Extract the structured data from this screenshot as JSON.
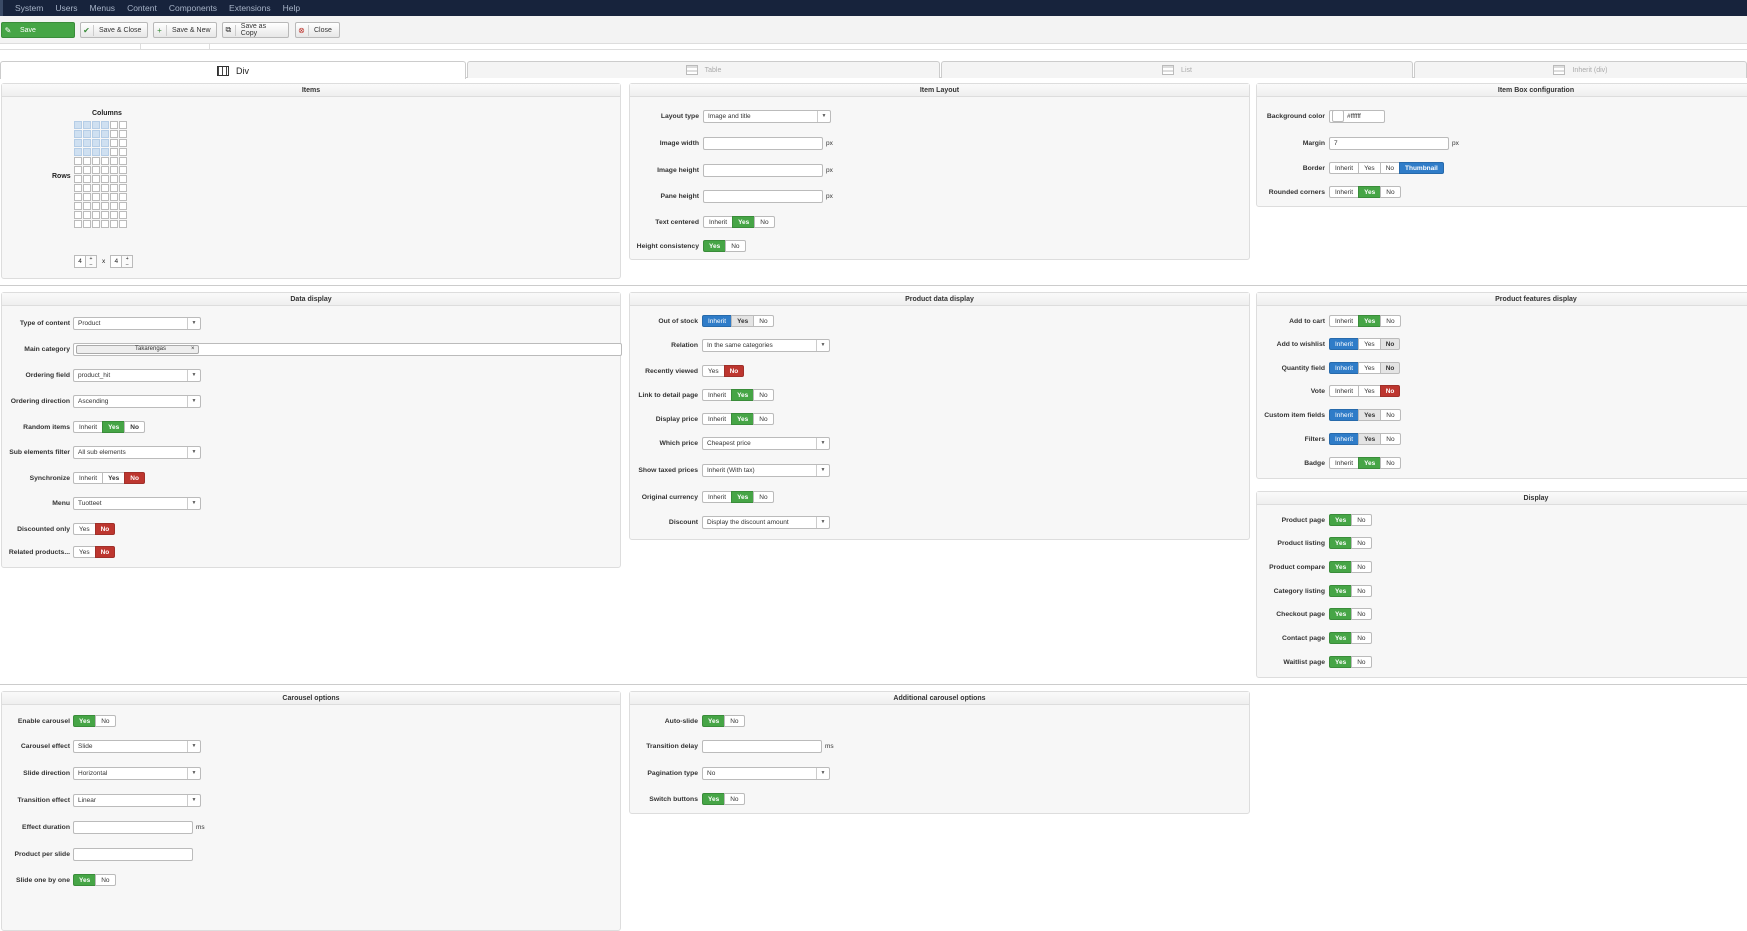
{
  "nav": [
    "System",
    "Users",
    "Menus",
    "Content",
    "Components",
    "Extensions",
    "Help"
  ],
  "toolbar": {
    "save": "Save",
    "save_close": "Save & Close",
    "save_new": "Save & New",
    "save_copy": "Save as Copy",
    "close": "Close"
  },
  "tabs": [
    "Div",
    "Table",
    "List",
    "Inherit (div)"
  ],
  "items": {
    "title": "Items",
    "columns_label": "Columns",
    "rows_label": "Rows",
    "cols_value": "4",
    "x": "x",
    "rows_value": "4"
  },
  "layout": {
    "title": "Item Layout",
    "layout_type_label": "Layout type",
    "layout_type": "Image and title",
    "image_width": "Image width",
    "image_height": "Image height",
    "pane_height": "Pane height",
    "px": "px",
    "text_centered": "Text centered",
    "height_consistency": "Height consistency"
  },
  "box": {
    "title": "Item Box configuration",
    "bg_color": "Background color",
    "bg_value": "#ffffff",
    "margin": "Margin",
    "margin_value": "7",
    "border": "Border",
    "rounded": "Rounded corners",
    "thumbnail": "Thumbnail"
  },
  "opts": {
    "inherit": "Inherit",
    "yes": "Yes",
    "no": "No"
  },
  "data": {
    "title": "Data display",
    "type": "Type of content",
    "type_val": "Product",
    "main_cat": "Main category",
    "main_cat_tag": "Takarengas",
    "ordering": "Ordering field",
    "ordering_val": "product_hit",
    "direction": "Ordering direction",
    "direction_val": "Ascending",
    "random": "Random items",
    "sub_filter": "Sub elements filter",
    "sub_filter_val": "All sub elements",
    "sync": "Synchronize",
    "menu": "Menu",
    "menu_val": "Tuotteet",
    "discounted": "Discounted only",
    "related": "Related products..."
  },
  "pdata": {
    "title": "Product data display",
    "out_of_stock": "Out of stock",
    "relation": "Relation",
    "relation_val": "In the same categories",
    "recent": "Recently viewed",
    "link": "Link to detail page",
    "price": "Display price",
    "which": "Which price",
    "which_val": "Cheapest price",
    "taxed": "Show taxed prices",
    "taxed_val": "Inherit (With tax)",
    "orig_cur": "Original currency",
    "discount": "Discount",
    "discount_val": "Display the discount amount"
  },
  "feat": {
    "title": "Product features display",
    "cart": "Add to cart",
    "wishlist": "Add to wishlist",
    "qty": "Quantity field",
    "vote": "Vote",
    "custom": "Custom item fields",
    "filters": "Filters",
    "badge": "Badge"
  },
  "display": {
    "title": "Display",
    "product_page": "Product page",
    "listing": "Product listing",
    "compare": "Product compare",
    "category": "Category listing",
    "checkout": "Checkout page",
    "contact": "Contact page",
    "waitlist": "Waitlist page"
  },
  "carousel": {
    "title": "Carousel options",
    "enable": "Enable carousel",
    "effect": "Carousel effect",
    "effect_val": "Slide",
    "direction": "Slide direction",
    "direction_val": "Horizontal",
    "transition": "Transition effect",
    "transition_val": "Linear",
    "duration": "Effect duration",
    "ms": "ms",
    "per_slide": "Product per slide",
    "one_by_one": "Slide one by one"
  },
  "addcar": {
    "title": "Additional carousel options",
    "auto": "Auto-slide",
    "delay": "Transition delay",
    "pagination": "Pagination type",
    "pagination_val": "No",
    "switch": "Switch buttons"
  }
}
